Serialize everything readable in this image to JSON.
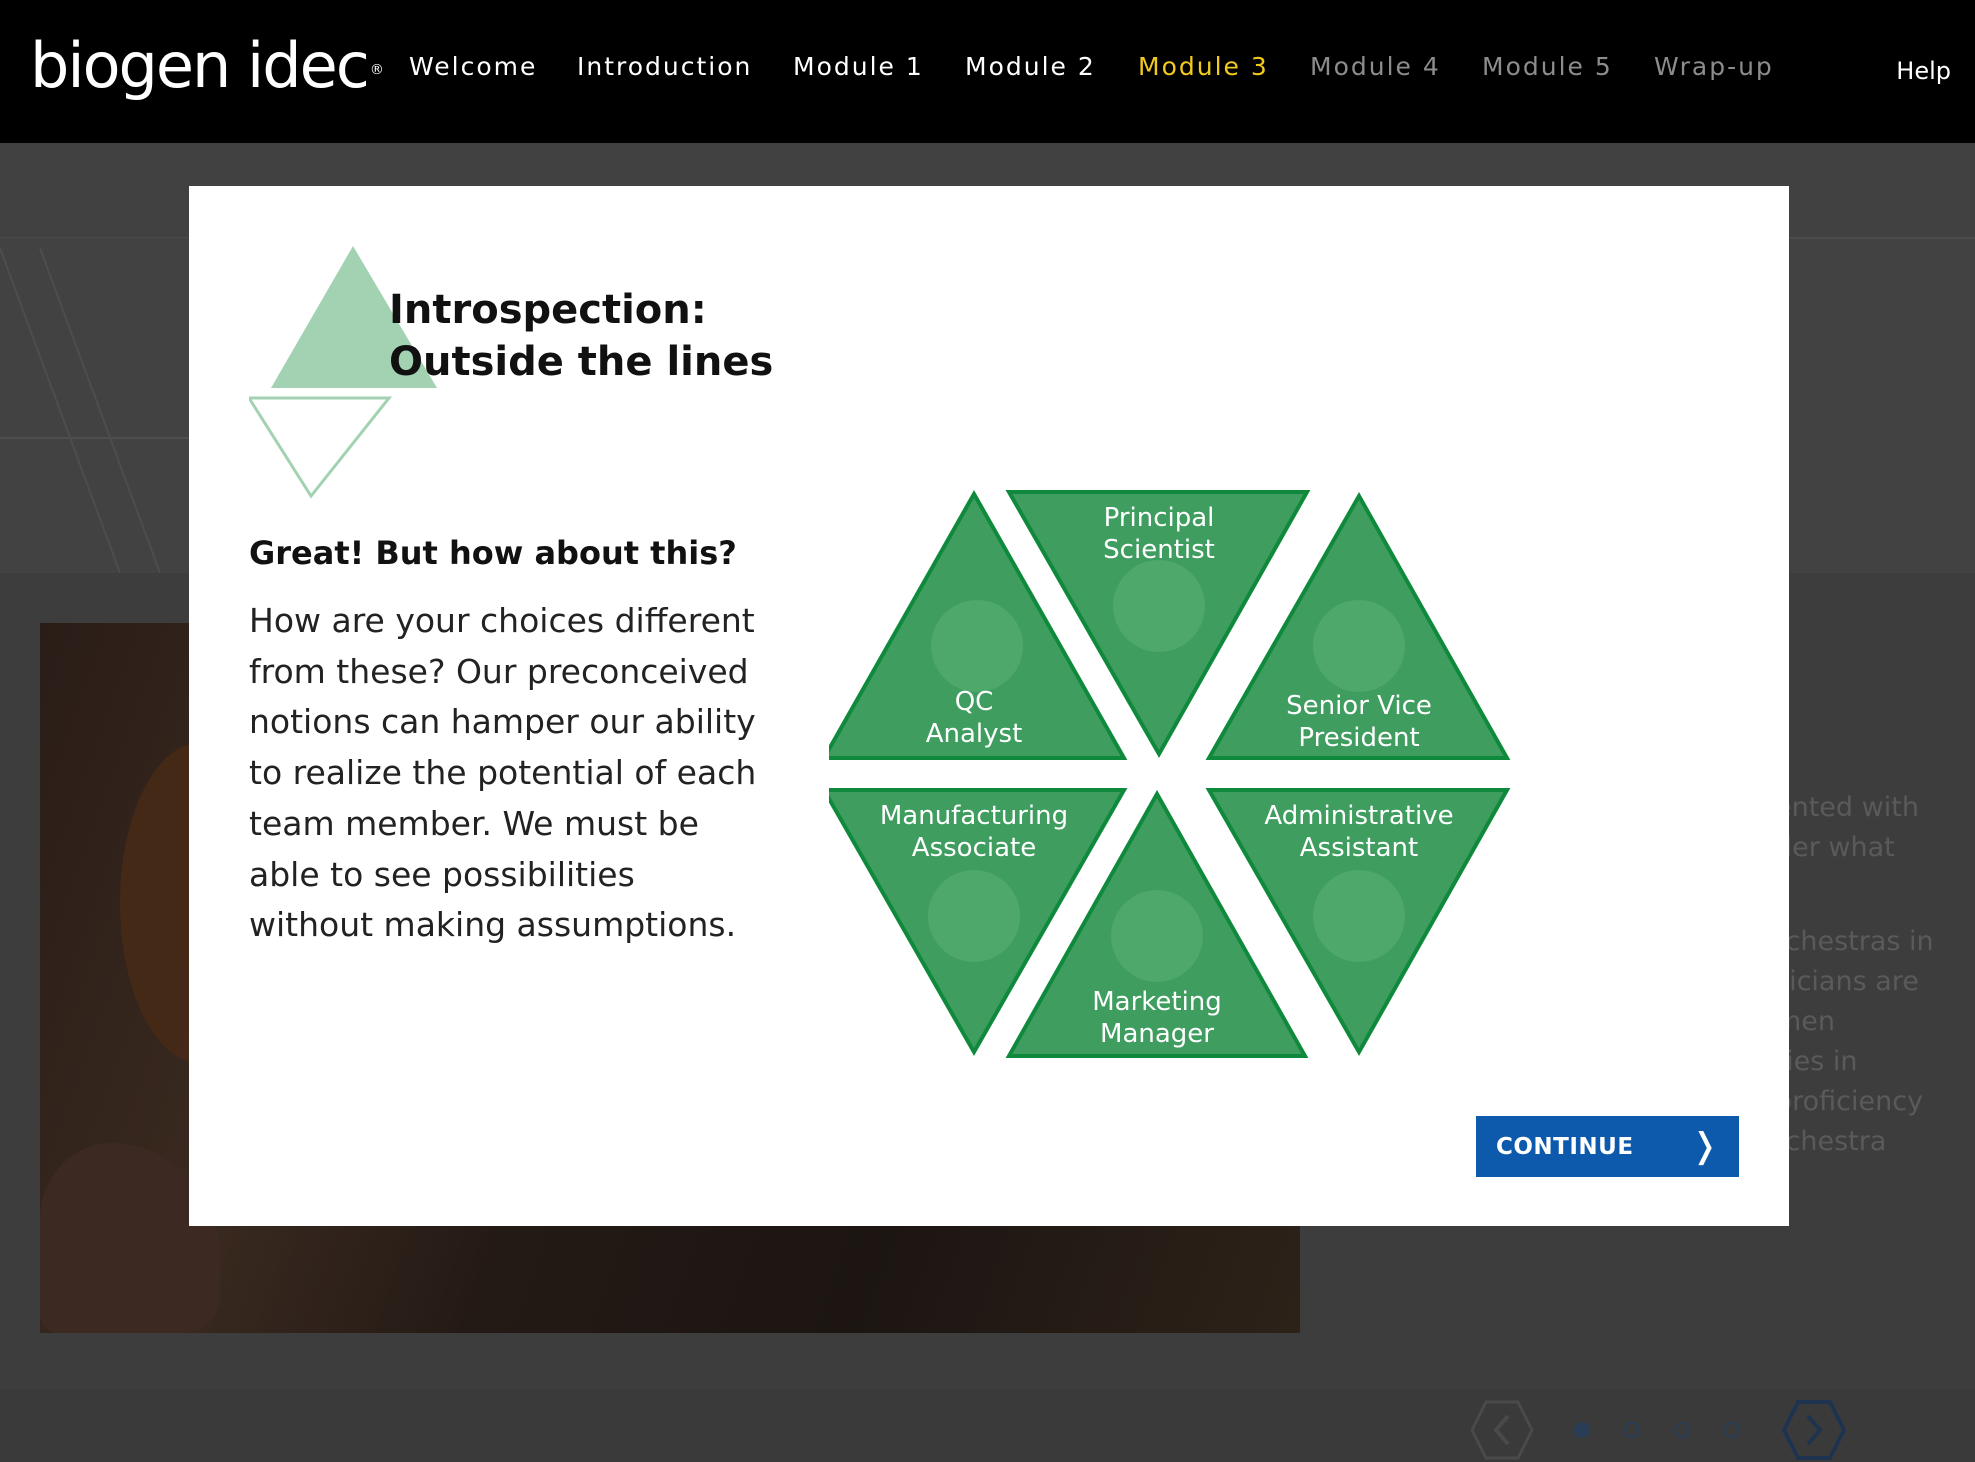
{
  "header": {
    "logo": "biogen idec",
    "logo_mark": "®",
    "nav": [
      {
        "label": "Welcome",
        "state": "active"
      },
      {
        "label": "Introduction",
        "state": "active"
      },
      {
        "label": "Module 1",
        "state": "active"
      },
      {
        "label": "Module 2",
        "state": "active"
      },
      {
        "label": "Module 3",
        "state": "current"
      },
      {
        "label": "Module 4",
        "state": "locked"
      },
      {
        "label": "Module 5",
        "state": "locked"
      },
      {
        "label": "Wrap-up",
        "state": "locked"
      }
    ],
    "help_label": "Help"
  },
  "colors": {
    "nav_active": "#ffffff",
    "nav_current": "#f2c91e",
    "nav_locked": "#8c8c8c",
    "triangle_fill": "#3f9d5f",
    "triangle_stroke": "#0f8a3c",
    "title_mark_fill": "#a3d2b3",
    "continue_bg": "#0d5aad"
  },
  "background_page": {
    "text_lines_1": [
      "ented with",
      "der what"
    ],
    "text_lines_2": [
      "rchestras in",
      "sicians are",
      "men",
      "ries in",
      "proficiency",
      "rchestra"
    ],
    "pager": {
      "dots": 4,
      "active_index": 0,
      "prev_icon": "chevron-left-icon",
      "next_icon": "chevron-right-icon"
    }
  },
  "modal": {
    "title_line1": "Introspection:",
    "title_line2": "Outside the lines",
    "subheading": "Great! But how about this?",
    "body": "How are your choices different from these? Our preconceived notions can hamper our ability to realize the potential of each team member. We must be able to see possibilities without making assumptions.",
    "roles": [
      {
        "line1": "QC",
        "line2": "Analyst"
      },
      {
        "line1": "Principal",
        "line2": "Scientist"
      },
      {
        "line1": "Senior Vice",
        "line2": "President"
      },
      {
        "line1": "Manufacturing",
        "line2": "Associate"
      },
      {
        "line1": "Marketing",
        "line2": "Manager"
      },
      {
        "line1": "Administrative",
        "line2": "Assistant"
      }
    ],
    "continue_label": "CONTINUE",
    "continue_icon": "❭"
  }
}
